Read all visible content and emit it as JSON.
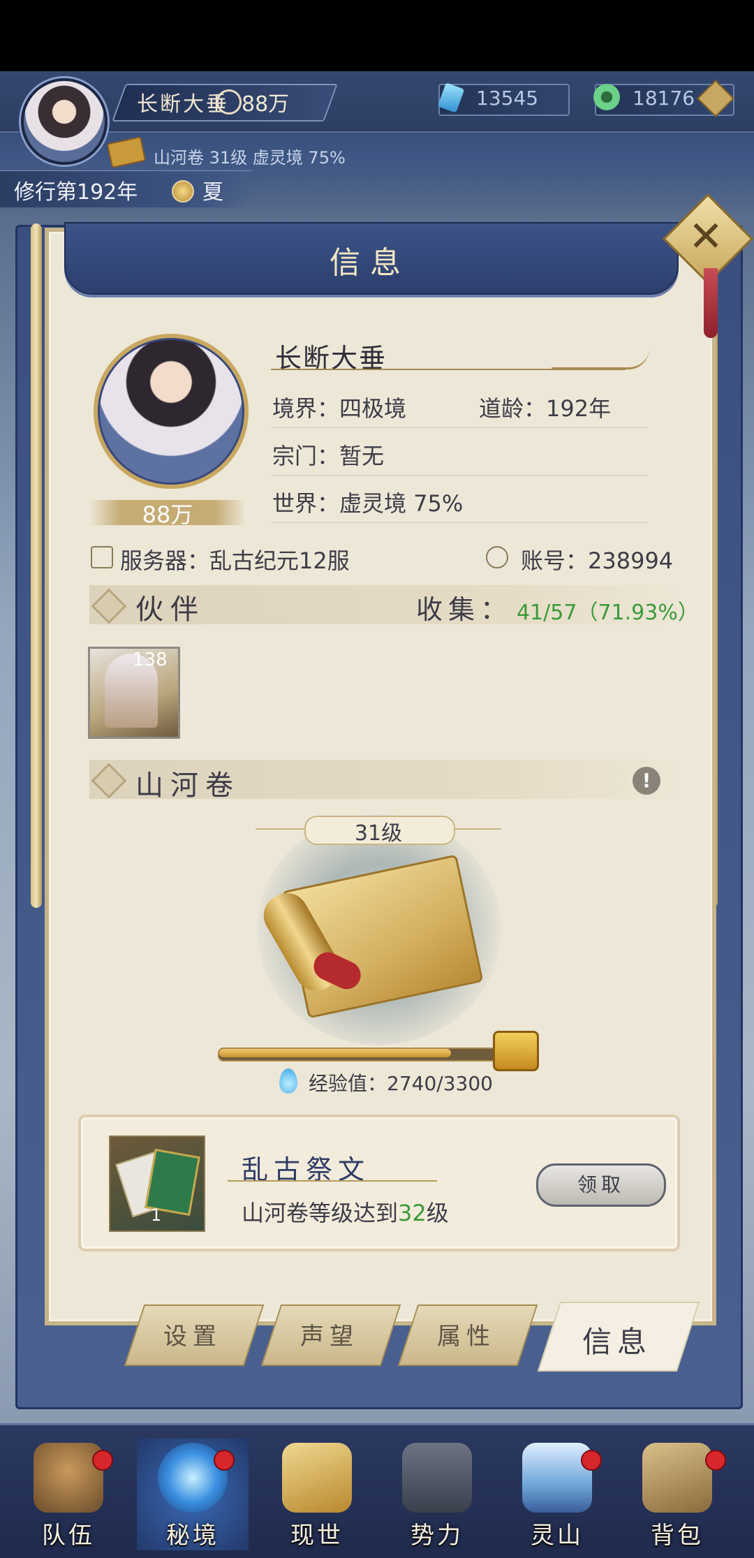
{
  "top_bar": {
    "player_name": "长断大垂",
    "power": "88万",
    "resource_1": "13545",
    "resource_2": "18176",
    "scroll_info": "山河卷 31级 虚灵境 75%",
    "cultivation_year": "修行第192年",
    "season": "夏"
  },
  "panel": {
    "title": "信息",
    "profile": {
      "name": "长断大垂",
      "power": "88万",
      "realm_label": "境界：四极境",
      "age_label": "道龄：192年",
      "sect_label": "宗门：暂无",
      "world_label": "世界：虚灵境  75%",
      "server_label": "服务器：乱古纪元12服",
      "account_label": "账号：238994"
    },
    "partners": {
      "title": "伙伴",
      "collect_label": "收集：",
      "collect_value": "41/57（71.93%）",
      "items": [
        {
          "level": "138"
        }
      ]
    },
    "shanhe": {
      "title": "山河卷",
      "level": "31级",
      "exp_label": "经验值：2740/3300",
      "exp_fraction": 0.83
    },
    "reward": {
      "name": "乱古祭文",
      "count": "1",
      "desc_prefix": "山河卷等级达到",
      "desc_level": "32",
      "desc_suffix": "级",
      "claim_label": "领取"
    }
  },
  "tabs": [
    {
      "label": "设置",
      "active": false
    },
    {
      "label": "声望",
      "active": false
    },
    {
      "label": "属性",
      "active": false
    },
    {
      "label": "信息",
      "active": true
    }
  ],
  "bottom_nav": [
    {
      "label": "队伍",
      "badge": true,
      "icon": "team-icon"
    },
    {
      "label": "秘境",
      "badge": true,
      "icon": "secret-realm-icon"
    },
    {
      "label": "现世",
      "badge": false,
      "icon": "world-icon"
    },
    {
      "label": "势力",
      "badge": false,
      "icon": "faction-icon"
    },
    {
      "label": "灵山",
      "badge": true,
      "icon": "mountain-icon"
    },
    {
      "label": "背包",
      "badge": true,
      "icon": "backpack-icon"
    }
  ],
  "colors": {
    "accent_gold": "#c8a860",
    "panel_bg": "#ede7d7",
    "navy": "#3d5388",
    "green_text": "#3a9a3a",
    "badge_red": "#d7262c"
  }
}
